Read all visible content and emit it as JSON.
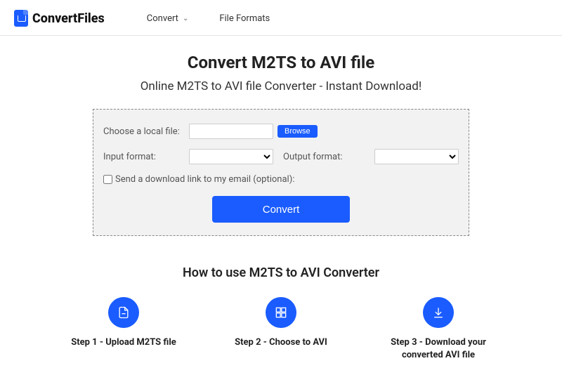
{
  "header": {
    "brand": "ConvertFiles",
    "nav": {
      "convert": "Convert",
      "formats": "File Formats"
    }
  },
  "page": {
    "title": "Convert M2TS to AVI file",
    "subtitle": "Online M2TS to AVI file Converter - Instant Download!"
  },
  "form": {
    "choose_file_label": "Choose a local file:",
    "browse": "Browse",
    "input_format_label": "Input format:",
    "output_format_label": "Output format:",
    "email_label": "Send a download link to my email (optional):",
    "convert": "Convert"
  },
  "howto": {
    "heading": "How to use M2TS to AVI Converter",
    "steps": {
      "s1": "Step 1 - Upload M2TS file",
      "s2": "Step 2 - Choose to AVI",
      "s3": "Step 3 - Download your converted AVI file"
    }
  }
}
